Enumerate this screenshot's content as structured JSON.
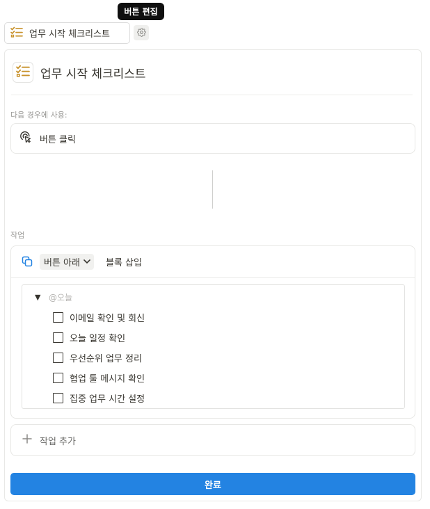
{
  "tooltip": {
    "text": "버튼 편집"
  },
  "button_chip": {
    "label": "업무 시작 체크리스트",
    "icon": "checklist-icon"
  },
  "header": {
    "title": "업무 시작 체크리스트",
    "icon": "checklist-icon"
  },
  "trigger": {
    "section_label": "다음 경우에 사용:",
    "label": "버튼 클릭",
    "icon": "click-icon"
  },
  "actions": {
    "section_label": "작업",
    "position_option": "버튼 아래",
    "action_suffix": "블록 삽입",
    "toggle_label": "@오늘",
    "todos": [
      {
        "label": "이메일 확인 및 회신",
        "checked": false
      },
      {
        "label": "오늘 일정 확인",
        "checked": false
      },
      {
        "label": "우선순위 업무 정리",
        "checked": false
      },
      {
        "label": "협업 툴 메시지 확인",
        "checked": false
      },
      {
        "label": "집중 업무 시간 설정",
        "checked": false
      }
    ]
  },
  "add_action": {
    "label": "작업 추가"
  },
  "done_button": {
    "label": "완료"
  },
  "colors": {
    "accent": "#2383e2",
    "checklist_icon": "#c8922b",
    "copy_icon": "#2383e2"
  }
}
